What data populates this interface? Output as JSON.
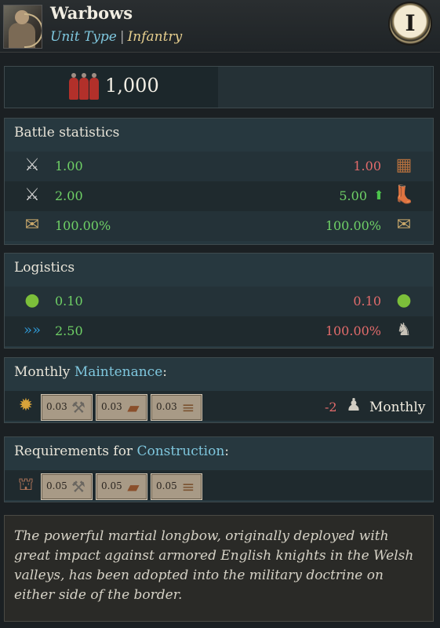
{
  "header": {
    "unit_name": "Warbows",
    "type_label": "Unit Type",
    "separator": "|",
    "type_value": "Infantry",
    "tier": "I"
  },
  "top": {
    "men_count": "1,000"
  },
  "battle": {
    "title": "Battle statistics",
    "rows": [
      {
        "left": "1.00",
        "right": "1.00"
      },
      {
        "left": "2.00",
        "right": "5.00"
      },
      {
        "left": "100.00%",
        "right": "100.00%"
      }
    ]
  },
  "logistics": {
    "title": "Logistics",
    "rows": [
      {
        "left": "0.10",
        "right": "0.10"
      },
      {
        "left": "2.50",
        "right": "100.00%"
      }
    ]
  },
  "maintenance": {
    "title_plain": "Monthly ",
    "title_hl": "Maintenance",
    "title_suffix": ":",
    "costs": [
      "0.03",
      "0.03",
      "0.03"
    ],
    "manpower": "-2",
    "period": "Monthly"
  },
  "construction": {
    "title_plain": "Requirements for ",
    "title_hl": "Construction",
    "title_suffix": ":",
    "costs": [
      "0.05",
      "0.05",
      "0.05"
    ]
  },
  "description": "The powerful martial longbow, originally deployed with great impact against armored English knights in the Welsh valleys, has been adopted into the military doctrine on either side of the border.",
  "colors": {
    "positive": "#6fd066",
    "negative": "#e26b6b",
    "highlight": "#7fc7de"
  },
  "icons": [
    "unit-portrait-icon",
    "tier-badge-icon",
    "men-icon",
    "archer-icon",
    "melee-attack-icon",
    "armor-icon",
    "ranged-attack-icon",
    "speed-icon",
    "morale-icon",
    "discipline-icon",
    "food-icon",
    "supply-icon",
    "movement-icon",
    "attrition-icon",
    "gold-icon",
    "weapons-icon",
    "leather-icon",
    "wood-icon",
    "manpower-icon",
    "workshop-icon"
  ]
}
